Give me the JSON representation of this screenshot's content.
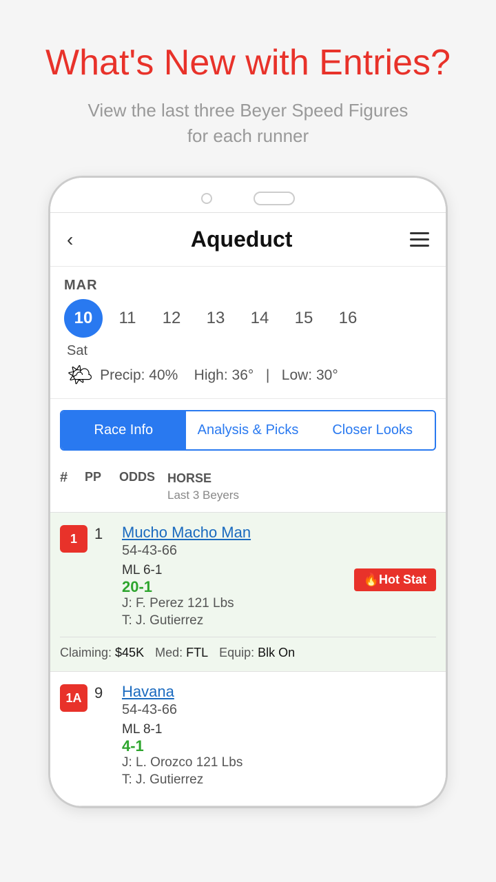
{
  "page": {
    "title": "What's New with Entries?",
    "subtitle": "View the last three Beyer Speed Figures\nfor each runner"
  },
  "navbar": {
    "title": "Aqueduct",
    "back_label": "‹",
    "menu_label": "menu"
  },
  "calendar": {
    "month": "MAR",
    "dates": [
      {
        "num": "10",
        "active": true
      },
      {
        "num": "11",
        "active": false
      },
      {
        "num": "12",
        "active": false
      },
      {
        "num": "13",
        "active": false
      },
      {
        "num": "14",
        "active": false
      },
      {
        "num": "15",
        "active": false
      },
      {
        "num": "16",
        "active": false
      }
    ],
    "day": "Sat",
    "weather": {
      "icon": "🌤",
      "precip_label": "Precip:",
      "precip_val": "40%",
      "high_label": "High:",
      "high_val": "36°",
      "separator": "|",
      "low_label": "Low:",
      "low_val": "30°"
    }
  },
  "tabs": [
    {
      "label": "Race Info",
      "active": true
    },
    {
      "label": "Analysis & Picks",
      "active": false
    },
    {
      "label": "Closer Looks",
      "active": false
    }
  ],
  "table_header": {
    "hash": "#",
    "pp": "PP",
    "odds": "ODDS",
    "horse": "HORSE",
    "last_beyers": "Last 3 Beyers"
  },
  "runners": [
    {
      "badge": "1",
      "pp": "1",
      "ml_label": "ML 6-1",
      "odds": "20-1",
      "odds_color": "green",
      "name": "Mucho Macho Man",
      "beyers": "54-43-66",
      "jockey": "J: F. Perez",
      "jockey_weight": "121 Lbs",
      "trainer": "T: J. Gutierrez",
      "hot_stat": true,
      "hot_stat_label": "🔥Hot Stat",
      "bg": "green",
      "claiming": "$45K",
      "med": "FTL",
      "equip": "Blk On"
    },
    {
      "badge": "1A",
      "pp": "9",
      "ml_label": "ML 8-1",
      "odds": "4-1",
      "odds_color": "green",
      "name": "Havana",
      "beyers": "54-43-66",
      "jockey": "J: L. Orozco",
      "jockey_weight": "121 Lbs",
      "trainer": "T: J. Gutierrez",
      "hot_stat": false,
      "bg": "white",
      "claiming": "",
      "med": "",
      "equip": ""
    }
  ],
  "colors": {
    "accent_blue": "#2979f0",
    "accent_red": "#e8322a",
    "green_odds": "#2ea52e",
    "green_bg": "#f0f7ee"
  }
}
